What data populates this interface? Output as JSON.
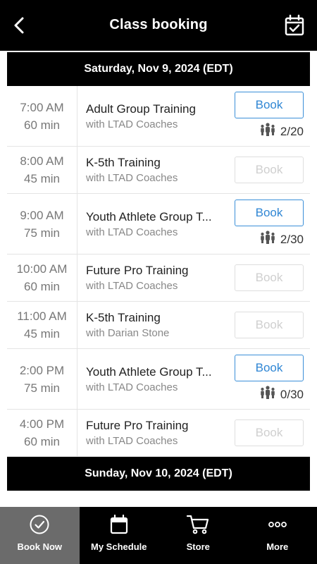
{
  "header": {
    "title": "Class booking"
  },
  "days": [
    {
      "label": "Saturday, Nov 9, 2024 (EDT)",
      "classes": [
        {
          "time": "7:00  AM",
          "duration": "60 min",
          "name": "Adult Group Training",
          "coach": "with LTAD Coaches",
          "button": "Book",
          "enabled": true,
          "count": "2/20"
        },
        {
          "time": "8:00  AM",
          "duration": "45 min",
          "name": "K-5th Training",
          "coach": "with LTAD Coaches",
          "button": "Book",
          "enabled": false,
          "count": ""
        },
        {
          "time": "9:00  AM",
          "duration": "75 min",
          "name": "Youth Athlete Group T...",
          "coach": "with LTAD Coaches",
          "button": "Book",
          "enabled": true,
          "count": "2/30"
        },
        {
          "time": "10:00  AM",
          "duration": "60 min",
          "name": "Future Pro Training",
          "coach": "with LTAD Coaches",
          "button": "Book",
          "enabled": false,
          "count": ""
        },
        {
          "time": "11:00  AM",
          "duration": "45 min",
          "name": "K-5th Training",
          "coach": "with Darian Stone",
          "button": "Book",
          "enabled": false,
          "count": ""
        },
        {
          "time": "2:00  PM",
          "duration": "75 min",
          "name": "Youth Athlete Group T...",
          "coach": "with LTAD Coaches",
          "button": "Book",
          "enabled": true,
          "count": "0/30"
        },
        {
          "time": "4:00  PM",
          "duration": "60 min",
          "name": "Future Pro Training",
          "coach": "with LTAD Coaches",
          "button": "Book",
          "enabled": false,
          "count": ""
        }
      ]
    },
    {
      "label": "Sunday, Nov 10, 2024 (EDT)",
      "classes": []
    }
  ],
  "tabs": [
    {
      "label": "Book Now",
      "icon": "check-circle-icon",
      "active": true
    },
    {
      "label": "My Schedule",
      "icon": "calendar-icon",
      "active": false
    },
    {
      "label": "Store",
      "icon": "cart-icon",
      "active": false
    },
    {
      "label": "More",
      "icon": "more-dots-icon",
      "active": false
    }
  ]
}
